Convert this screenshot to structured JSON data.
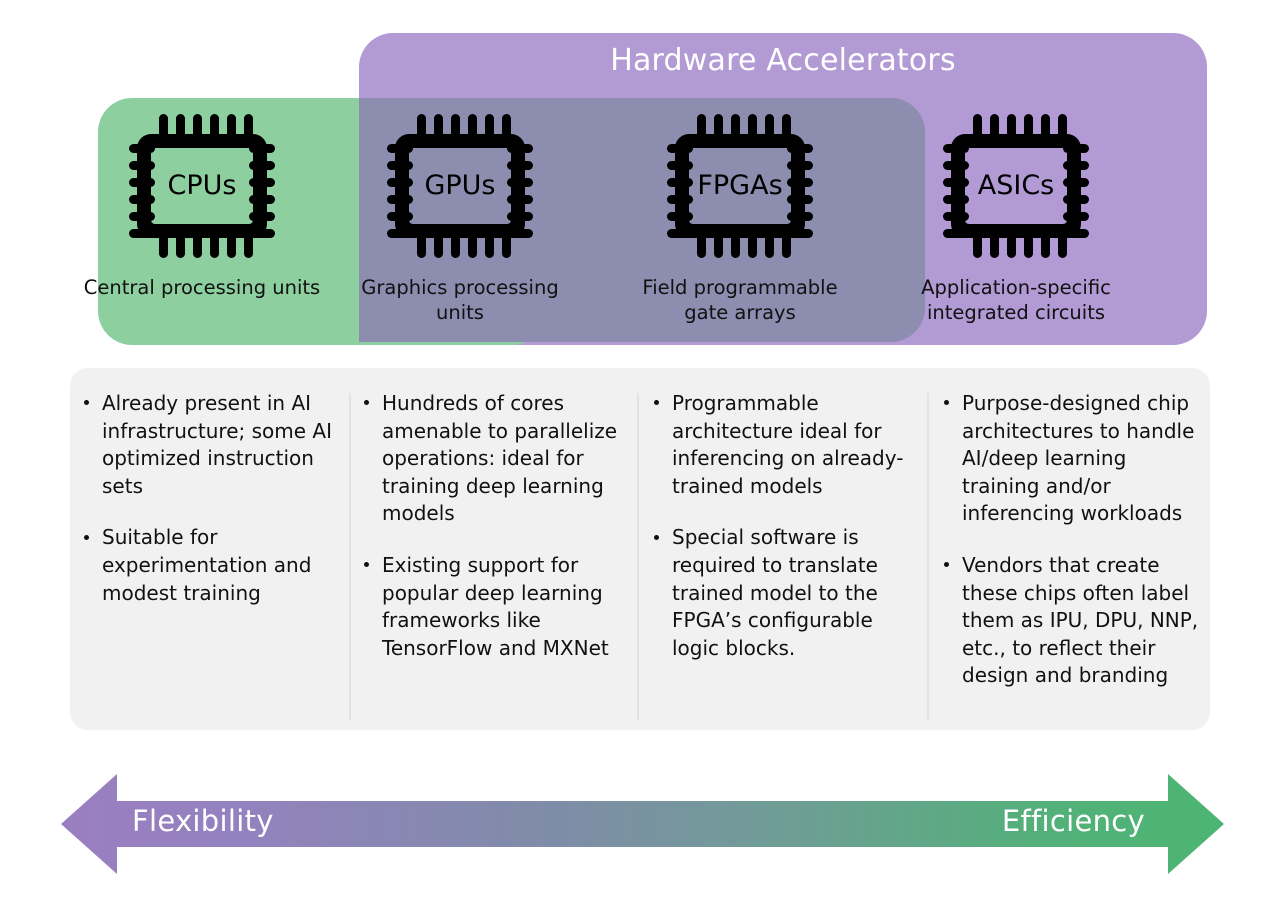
{
  "colors": {
    "green": "#8ecfa0",
    "purple": "#b29ad4",
    "overlap_gray": "#8d8daf",
    "panel_bg": "#f1f1f1",
    "divider": "#e2e2e2",
    "text": "#111111",
    "band_title_text": "#ffffff"
  },
  "accelerators": {
    "title": "Hardware Accelerators"
  },
  "categories": [
    {
      "id": "cpus",
      "icon": "chip-icon",
      "label": "CPUs",
      "caption": "Central processing units",
      "bullets": [
        "Already present in AI infrastructure; some AI optimized instruction sets",
        "Suitable for experimentation and modest training"
      ]
    },
    {
      "id": "gpus",
      "icon": "chip-icon",
      "label": "GPUs",
      "caption": "Graphics processing units",
      "bullets": [
        "Hundreds of cores amenable to parallelize operations: ideal for training deep learning models",
        "Existing support for popular deep learning frameworks like TensorFlow and MXNet"
      ]
    },
    {
      "id": "fpgas",
      "icon": "chip-icon",
      "label": "FPGAs",
      "caption": "Field programmable gate arrays",
      "bullets": [
        "Programmable architecture ideal for inferencing on already-trained models",
        "Special software is required to translate trained model to the FPGA’s configurable logic blocks."
      ]
    },
    {
      "id": "asics",
      "icon": "chip-icon",
      "label": "ASICs",
      "caption": "Application-specific integrated circuits",
      "bullets": [
        "Purpose-designed chip architectures to handle AI/deep learning training and/or inferencing workloads",
        "Vendors that create these chips often label them as IPU, DPU, NNP, etc., to reflect their design and branding"
      ]
    }
  ],
  "spectrum": {
    "left_label": "Flexibility",
    "right_label": "Efficiency",
    "gradient_from": "#9a7fc0",
    "gradient_to": "#4cb573"
  }
}
